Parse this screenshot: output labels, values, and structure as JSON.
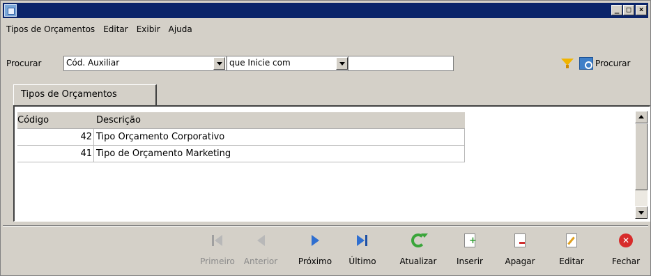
{
  "menu": {
    "items": [
      {
        "label": "Tipos de Orçamentos"
      },
      {
        "label": "Editar"
      },
      {
        "label": "Exibir"
      },
      {
        "label": "Ajuda"
      }
    ]
  },
  "search": {
    "label": "Procurar",
    "field_value": "Cód. Auxiliar",
    "operator_value": "que Inicie com",
    "text_value": "",
    "button_label": "Procurar"
  },
  "tab": {
    "label": "Tipos de Orçamentos"
  },
  "grid": {
    "columns": [
      "Código",
      "Descrição"
    ],
    "rows": [
      {
        "codigo": "42",
        "descricao": "Tipo Orçamento Corporativo"
      },
      {
        "codigo": "41",
        "descricao": "Tipo de Orçamento Marketing"
      }
    ]
  },
  "toolbar": {
    "first": "Primeiro",
    "prev": "Anterior",
    "next": "Próximo",
    "last": "Último",
    "refresh": "Atualizar",
    "insert": "Inserir",
    "delete": "Apagar",
    "edit": "Editar",
    "close": "Fechar"
  },
  "colors": {
    "titlebar": "#0a246a",
    "window_bg": "#d4d0c8",
    "nav_active": "#2f6fd0",
    "refresh": "#3aa53a",
    "close": "#d72b2b"
  }
}
